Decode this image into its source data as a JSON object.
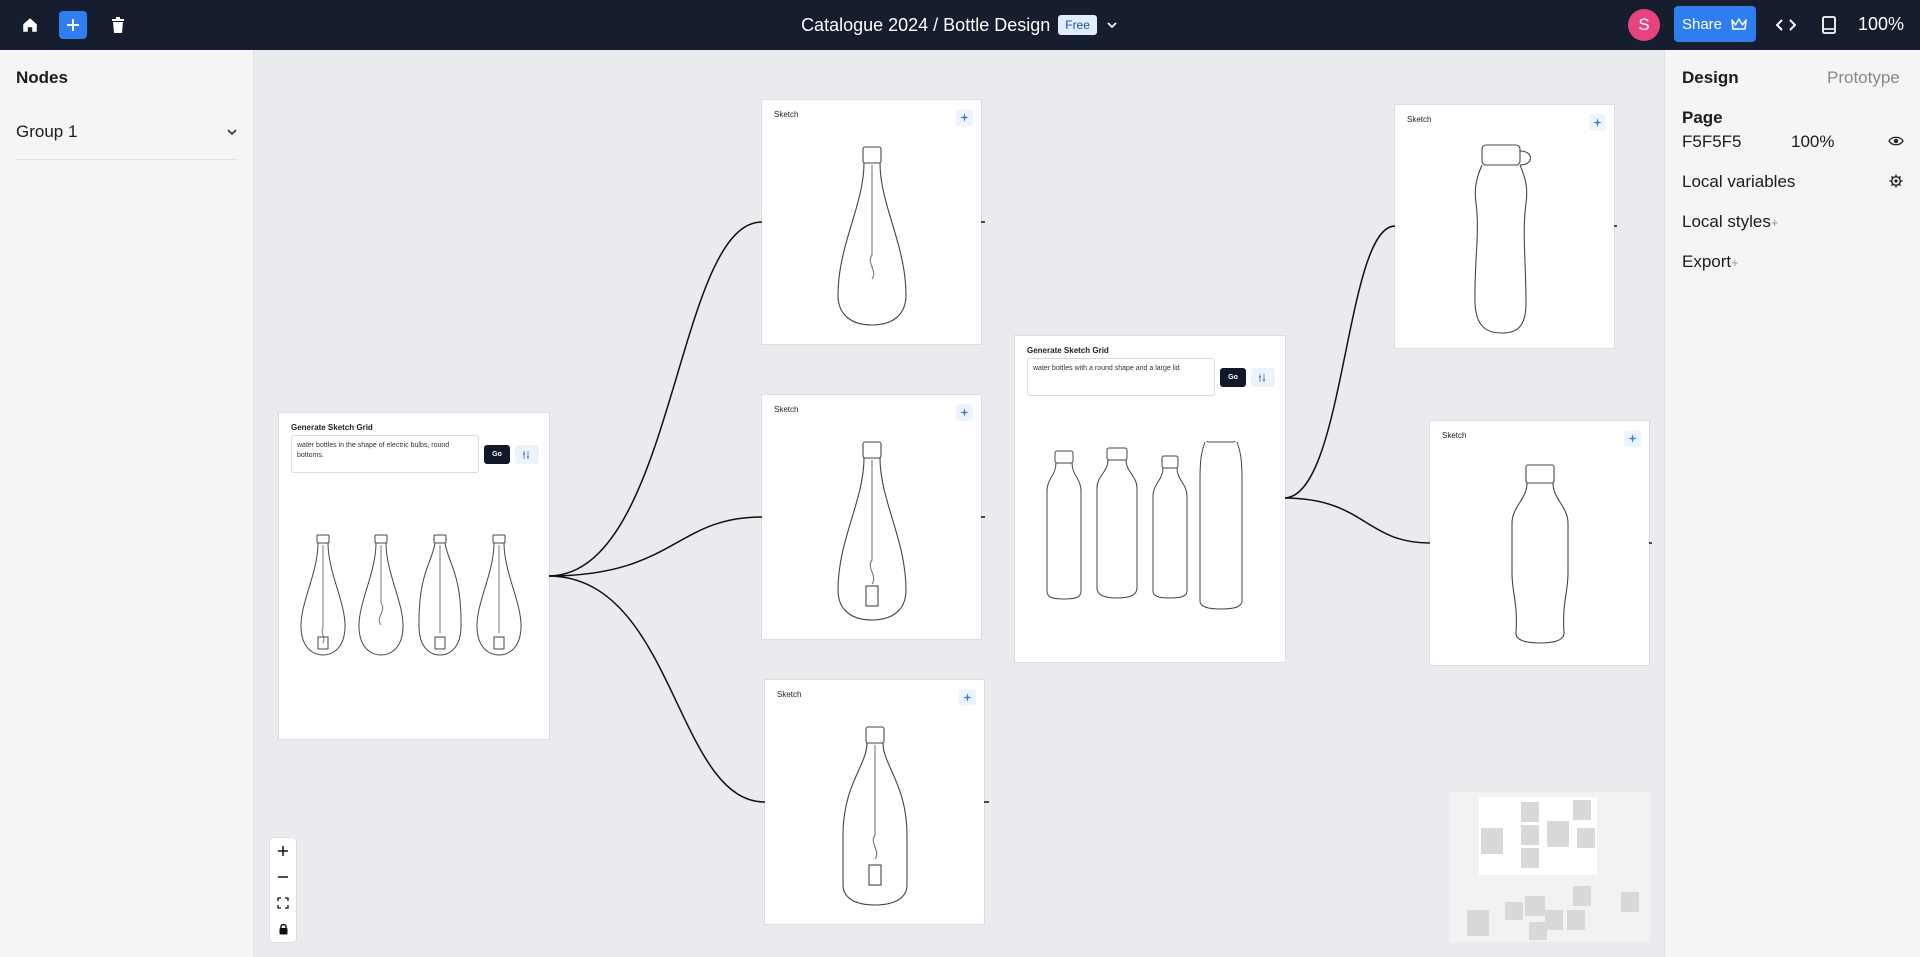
{
  "topbar": {
    "breadcrumb": "Catalogue 2024 / Bottle Design",
    "plan_badge": "Free",
    "avatar_initial": "S",
    "share_label": "Share",
    "zoom": "100%",
    "icons": [
      "home-icon",
      "plus-icon",
      "trash-icon",
      "chevron-down-icon",
      "crown-icon",
      "code-icon",
      "book-icon"
    ]
  },
  "left_panel": {
    "title": "Nodes",
    "groups": [
      {
        "label": "Group 1"
      }
    ]
  },
  "right_panel": {
    "tabs": {
      "design": "Design",
      "prototype": "Prototype"
    },
    "page_label": "Page",
    "page_color": "F5F5F5",
    "page_opacity": "100%",
    "local_variables": "Local variables",
    "local_styles": "Local styles",
    "export": "Export",
    "add_symbol": "+"
  },
  "canvas": {
    "generator_1": {
      "title": "Generate Sketch Grid",
      "prompt": "water bottles in the shape of electric bulbs, round bottoms.",
      "go_label": "Go"
    },
    "generator_2": {
      "title": "Generate Sketch Grid",
      "prompt": "water bottles with a round shape and a large lid",
      "go_label": "Go"
    },
    "sketch_title": "Sketch",
    "sketch_cards": [
      {
        "title": "Sketch"
      },
      {
        "title": "Sketch"
      },
      {
        "title": "Sketch"
      },
      {
        "title": "Sketch"
      },
      {
        "title": "Sketch"
      }
    ]
  },
  "colors": {
    "topbar": "#151d2e",
    "accent": "#2f7ef0",
    "avatar": "#e5447e",
    "canvas": "#e9ebee",
    "panel": "#f5f5f5"
  }
}
